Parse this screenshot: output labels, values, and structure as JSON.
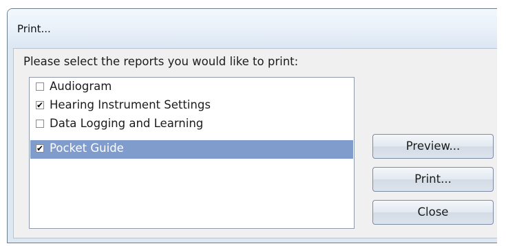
{
  "dialog": {
    "title": "Print...",
    "prompt": "Please select the reports you would like to print:",
    "reports": [
      {
        "label": "Audiogram",
        "checked": false,
        "selected": false
      },
      {
        "label": "Hearing Instrument Settings",
        "checked": true,
        "selected": false
      },
      {
        "label": "Data Logging and Learning",
        "checked": false,
        "selected": false
      },
      {
        "label": "Pocket Guide",
        "checked": true,
        "selected": true
      }
    ],
    "buttons": {
      "preview": "Preview...",
      "print": "Print...",
      "close": "Close"
    }
  },
  "colors": {
    "selection": "#7f9ccc",
    "dialog_frame": "#dde8f3"
  }
}
